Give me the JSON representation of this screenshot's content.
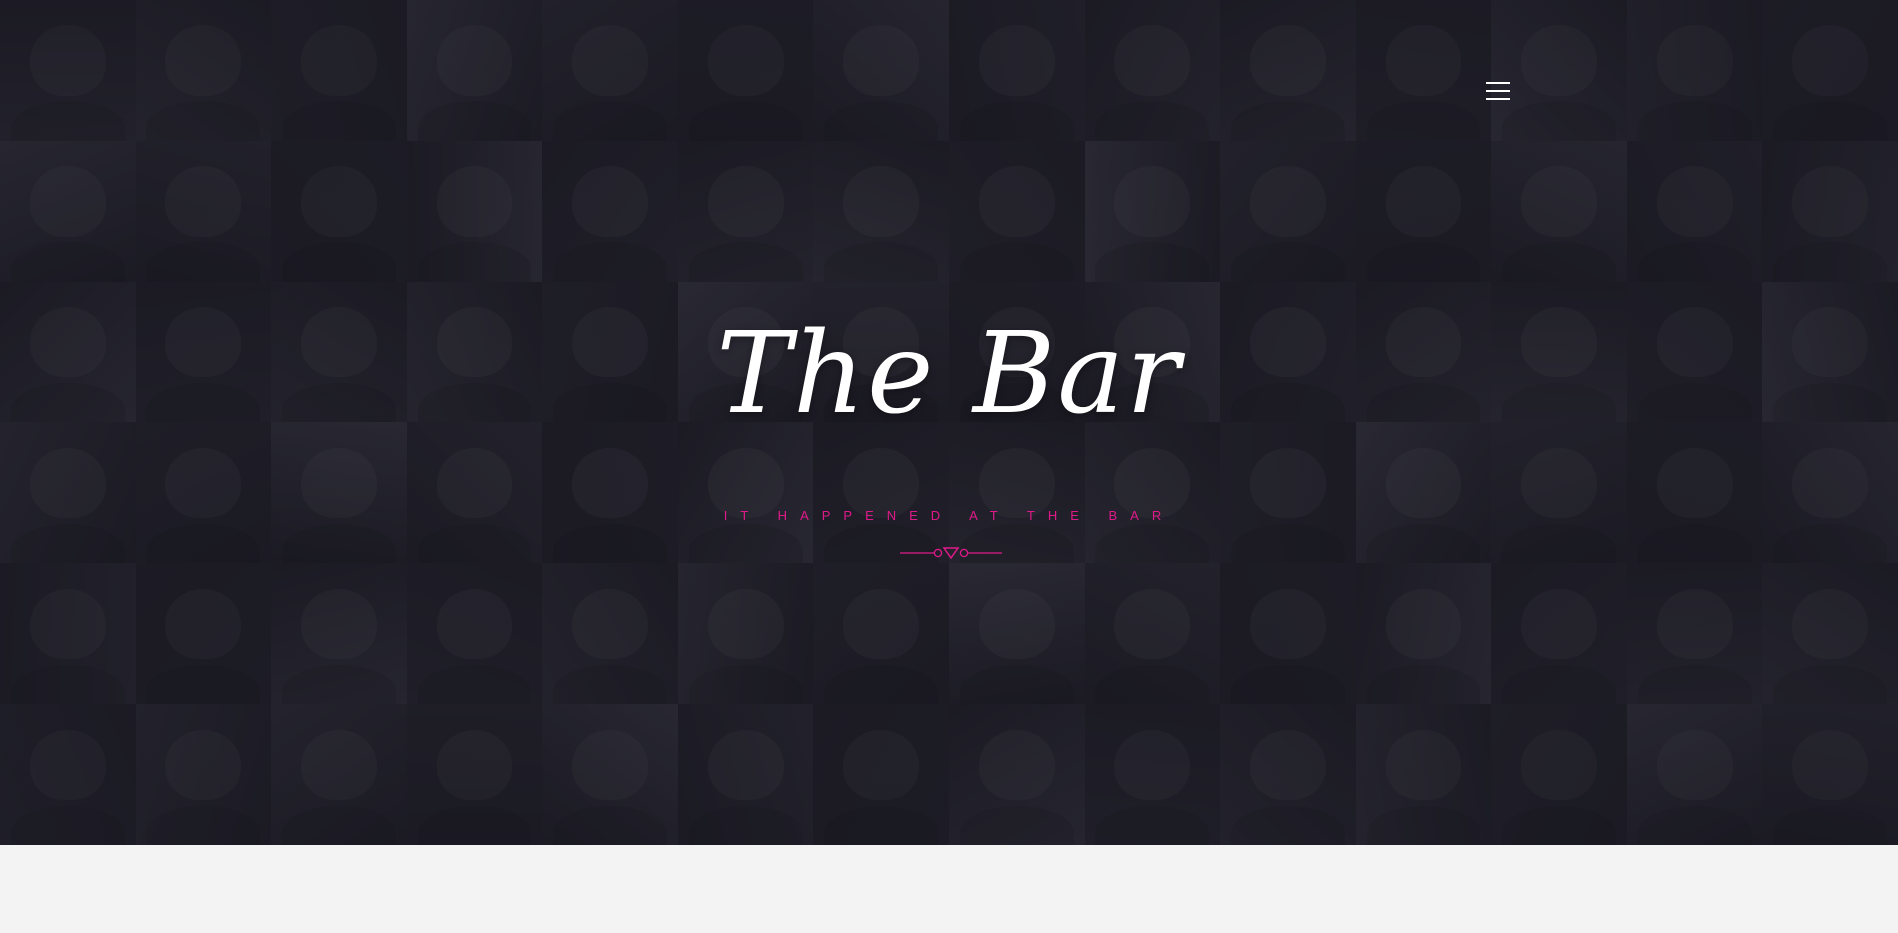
{
  "hero": {
    "title": "The Bar",
    "tagline": "IT HAPPENED AT THE BAR",
    "background": "photo-collage",
    "colors": {
      "background": "#1b1a23",
      "title": "#ffffff",
      "accent": "#e0198a"
    }
  },
  "nav": {
    "menu_icon": "hamburger-menu-icon"
  },
  "divider": {
    "icon": "triangle-ornament-icon"
  }
}
